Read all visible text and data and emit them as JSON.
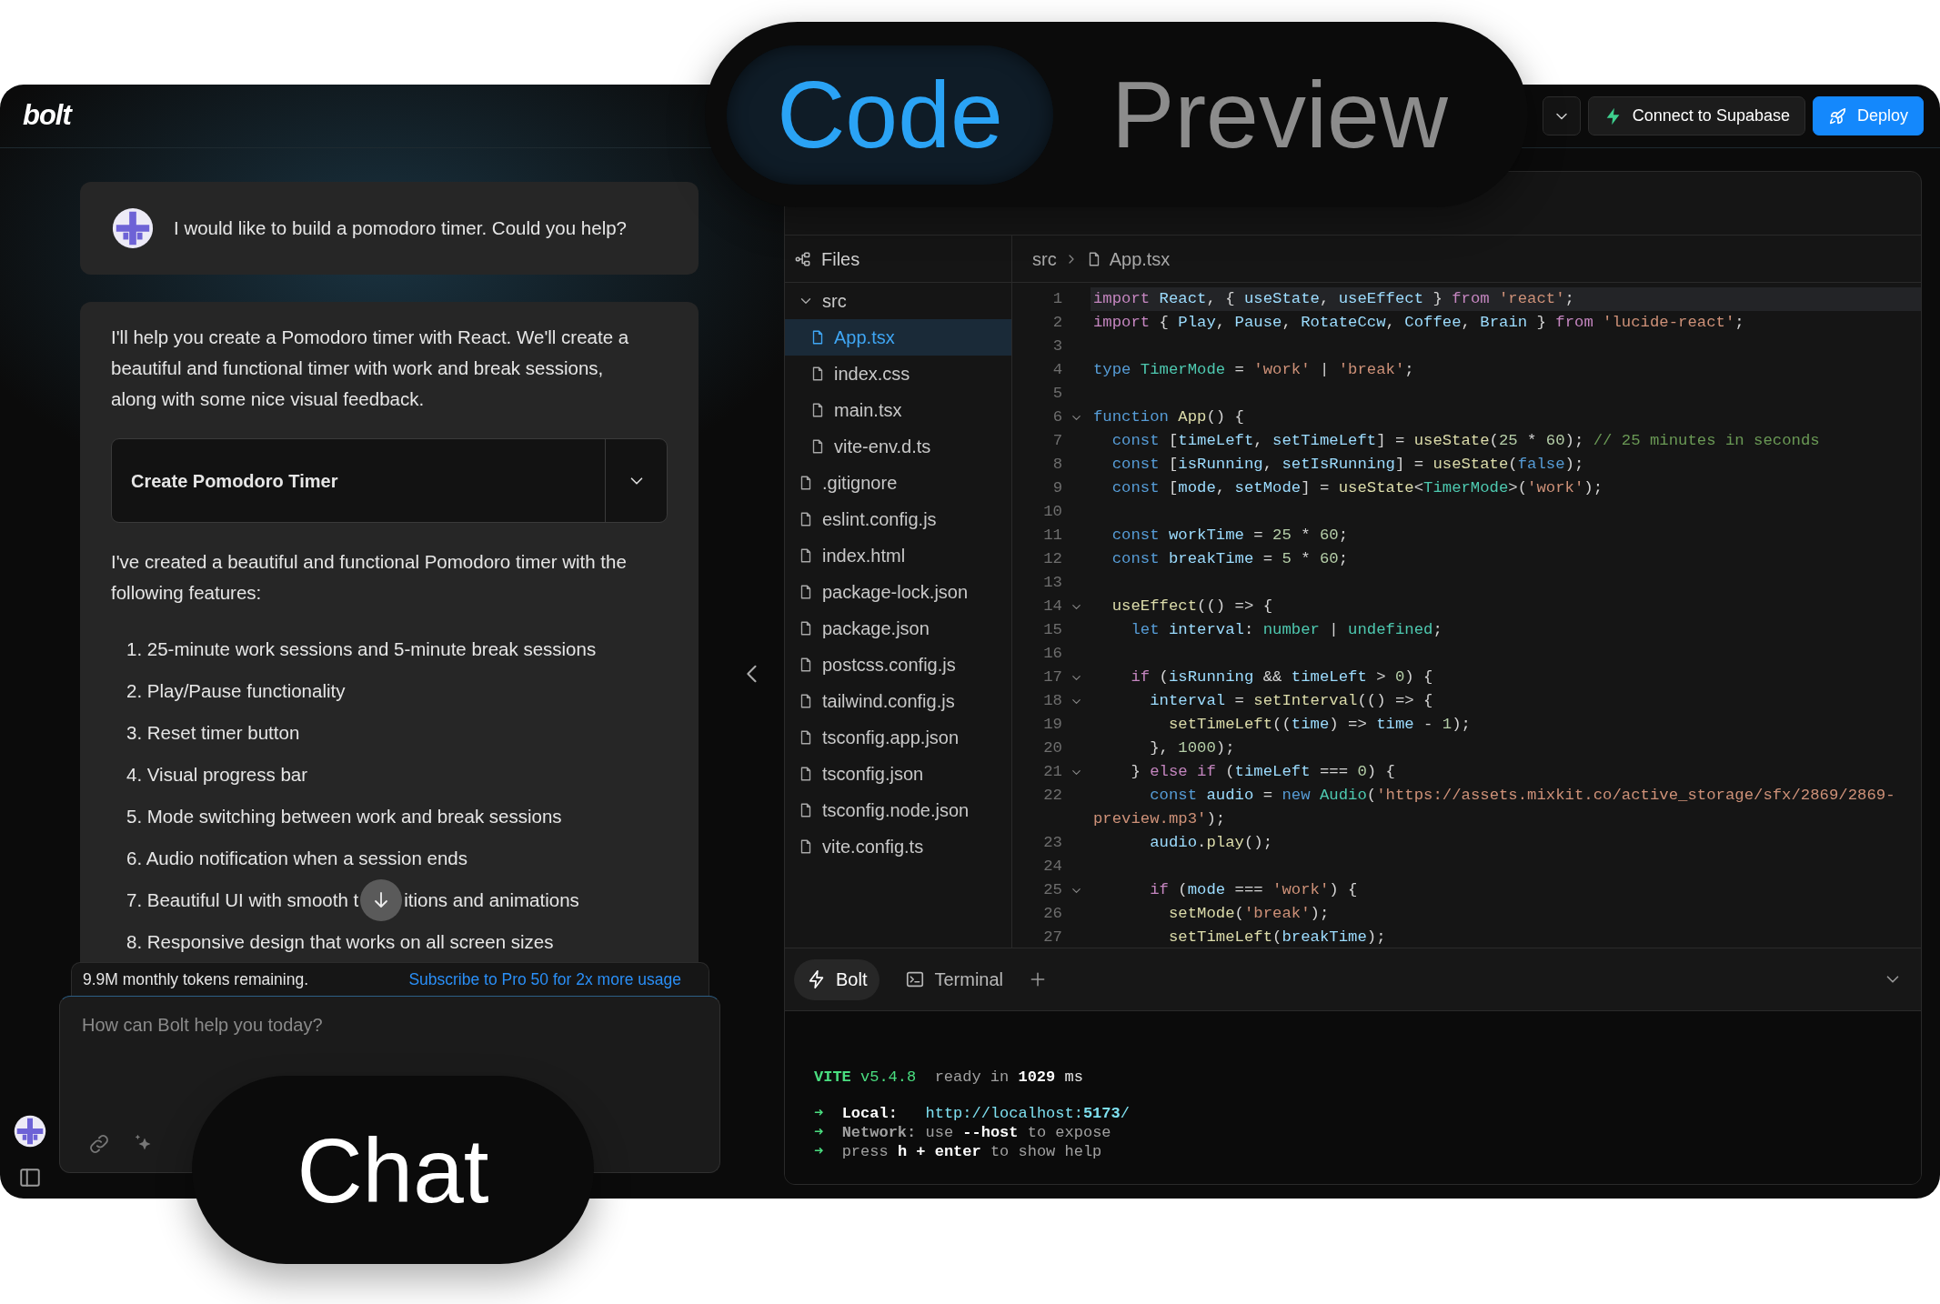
{
  "app": {
    "logo": "bolt"
  },
  "header_actions": [
    {
      "kind": "dropdown"
    },
    {
      "kind": "integration",
      "label": "Connect to Supabase"
    },
    {
      "kind": "primary",
      "label": "Deploy"
    }
  ],
  "chat": {
    "messages": [
      {
        "kind": "user",
        "text": "I would like to build a pomodoro timer. Could you help?"
      },
      {
        "kind": "assistant",
        "intro": "I'll help you create a Pomodoro timer with React. We'll create a beautiful and functional timer with work and break sessions, along with some nice visual feedback.",
        "artifact": {
          "title": "Create Pomodoro Timer",
          "expanded": false
        },
        "summary": "I've created a beautiful and functional Pomodoro timer with the following features:",
        "features": [
          "1. 25-minute work sessions and 5-minute break sessions",
          "2. Play/Pause functionality",
          "3. Reset timer button",
          "4. Visual progress bar",
          "5. Mode switching between work and break sessions",
          "6. Audio notification when a session ends",
          [
            "7. Beautiful UI with smooth t",
            "itions and animations"
          ],
          "8. Responsive design that works on all screen sizes"
        ]
      }
    ],
    "usage": {
      "remaining": "9.9M monthly tokens remaining.",
      "upgrade_link": "Subscribe to Pro 50 for 2x more usage"
    },
    "input": {
      "placeholder": "How can Bolt help you today?"
    }
  },
  "workbench": {
    "files_title": "Files",
    "tree": [
      {
        "name": "src",
        "kind": "folder",
        "expanded": true,
        "selected": false,
        "children": [
          {
            "name": "App.tsx",
            "kind": "file",
            "selected": true
          },
          {
            "name": "index.css",
            "kind": "file",
            "selected": false
          },
          {
            "name": "main.tsx",
            "kind": "file",
            "selected": false
          },
          {
            "name": "vite-env.d.ts",
            "kind": "file",
            "selected": false
          }
        ]
      },
      {
        "name": ".gitignore",
        "kind": "file",
        "selected": false
      },
      {
        "name": "eslint.config.js",
        "kind": "file",
        "selected": false
      },
      {
        "name": "index.html",
        "kind": "file",
        "selected": false
      },
      {
        "name": "package-lock.json",
        "kind": "file",
        "selected": false
      },
      {
        "name": "package.json",
        "kind": "file",
        "selected": false
      },
      {
        "name": "postcss.config.js",
        "kind": "file",
        "selected": false
      },
      {
        "name": "tailwind.config.js",
        "kind": "file",
        "selected": false
      },
      {
        "name": "tsconfig.app.json",
        "kind": "file",
        "selected": false
      },
      {
        "name": "tsconfig.json",
        "kind": "file",
        "selected": false
      },
      {
        "name": "tsconfig.node.json",
        "kind": "file",
        "selected": false
      },
      {
        "name": "vite.config.ts",
        "kind": "file",
        "selected": false
      }
    ],
    "breadcrumb": [
      "src",
      "App.tsx"
    ],
    "code_lines": [
      {
        "number": "1",
        "active": true,
        "foldable": false,
        "tokens": [
          {
            "kind": "keyword",
            "text": "import"
          },
          {
            "kind": "variable",
            "text": " React"
          },
          {
            "kind": "punct",
            "text": ", { "
          },
          {
            "kind": "variable",
            "text": "useState"
          },
          {
            "kind": "punct",
            "text": ", "
          },
          {
            "kind": "variable",
            "text": "useEffect"
          },
          {
            "kind": "punct",
            "text": " } "
          },
          {
            "kind": "keyword",
            "text": "from"
          },
          {
            "kind": "string",
            "text": " 'react'"
          },
          {
            "kind": "punct",
            "text": ";"
          }
        ]
      },
      {
        "number": "2",
        "active": false,
        "foldable": false,
        "tokens": [
          {
            "kind": "keyword",
            "text": "import"
          },
          {
            "kind": "punct",
            "text": " { "
          },
          {
            "kind": "variable",
            "text": "Play"
          },
          {
            "kind": "punct",
            "text": ", "
          },
          {
            "kind": "variable",
            "text": "Pause"
          },
          {
            "kind": "punct",
            "text": ", "
          },
          {
            "kind": "variable",
            "text": "RotateCcw"
          },
          {
            "kind": "punct",
            "text": ", "
          },
          {
            "kind": "variable",
            "text": "Coffee"
          },
          {
            "kind": "punct",
            "text": ", "
          },
          {
            "kind": "variable",
            "text": "Brain"
          },
          {
            "kind": "punct",
            "text": " } "
          },
          {
            "kind": "keyword",
            "text": "from"
          },
          {
            "kind": "string",
            "text": " 'lucide-react'"
          },
          {
            "kind": "punct",
            "text": ";"
          }
        ]
      },
      {
        "number": "3",
        "active": false,
        "foldable": false
      },
      {
        "number": "4",
        "active": false,
        "foldable": false,
        "tokens": [
          {
            "kind": "storage",
            "text": "type"
          },
          {
            "kind": "type",
            "text": " TimerMode"
          },
          {
            "kind": "punct",
            "text": " = "
          },
          {
            "kind": "string",
            "text": "'work'"
          },
          {
            "kind": "punct",
            "text": " | "
          },
          {
            "kind": "string",
            "text": "'break'"
          },
          {
            "kind": "punct",
            "text": ";"
          }
        ]
      },
      {
        "number": "5",
        "active": false,
        "foldable": false
      },
      {
        "number": "6",
        "active": false,
        "foldable": true,
        "tokens": [
          {
            "kind": "storage",
            "text": "function"
          },
          {
            "kind": "function",
            "text": " App"
          },
          {
            "kind": "punct",
            "text": "() {"
          }
        ]
      },
      {
        "number": "7",
        "active": false,
        "foldable": false,
        "tokens": [
          {
            "kind": "storage",
            "text": "  const"
          },
          {
            "kind": "punct",
            "text": " ["
          },
          {
            "kind": "variable",
            "text": "timeLeft"
          },
          {
            "kind": "punct",
            "text": ", "
          },
          {
            "kind": "variable",
            "text": "setTimeLeft"
          },
          {
            "kind": "punct",
            "text": "] = "
          },
          {
            "kind": "function",
            "text": "useState"
          },
          {
            "kind": "punct",
            "text": "("
          },
          {
            "kind": "number",
            "text": "25"
          },
          {
            "kind": "punct",
            "text": " * "
          },
          {
            "kind": "number",
            "text": "60"
          },
          {
            "kind": "punct",
            "text": "); "
          },
          {
            "kind": "comment",
            "text": "// 25 minutes in seconds"
          }
        ]
      },
      {
        "number": "8",
        "active": false,
        "foldable": false,
        "tokens": [
          {
            "kind": "storage",
            "text": "  const"
          },
          {
            "kind": "punct",
            "text": " ["
          },
          {
            "kind": "variable",
            "text": "isRunning"
          },
          {
            "kind": "punct",
            "text": ", "
          },
          {
            "kind": "variable",
            "text": "setIsRunning"
          },
          {
            "kind": "punct",
            "text": "] = "
          },
          {
            "kind": "function",
            "text": "useState"
          },
          {
            "kind": "punct",
            "text": "("
          },
          {
            "kind": "storage",
            "text": "false"
          },
          {
            "kind": "punct",
            "text": ");"
          }
        ]
      },
      {
        "number": "9",
        "active": false,
        "foldable": false,
        "tokens": [
          {
            "kind": "storage",
            "text": "  const"
          },
          {
            "kind": "punct",
            "text": " ["
          },
          {
            "kind": "variable",
            "text": "mode"
          },
          {
            "kind": "punct",
            "text": ", "
          },
          {
            "kind": "variable",
            "text": "setMode"
          },
          {
            "kind": "punct",
            "text": "] = "
          },
          {
            "kind": "function",
            "text": "useState"
          },
          {
            "kind": "punct",
            "text": "<"
          },
          {
            "kind": "type",
            "text": "TimerMode"
          },
          {
            "kind": "punct",
            "text": ">("
          },
          {
            "kind": "string",
            "text": "'work'"
          },
          {
            "kind": "punct",
            "text": ");"
          }
        ]
      },
      {
        "number": "10",
        "active": false,
        "foldable": false
      },
      {
        "number": "11",
        "active": false,
        "foldable": false,
        "tokens": [
          {
            "kind": "storage",
            "text": "  const"
          },
          {
            "kind": "variable",
            "text": " workTime"
          },
          {
            "kind": "punct",
            "text": " = "
          },
          {
            "kind": "number",
            "text": "25"
          },
          {
            "kind": "punct",
            "text": " * "
          },
          {
            "kind": "number",
            "text": "60"
          },
          {
            "kind": "punct",
            "text": ";"
          }
        ]
      },
      {
        "number": "12",
        "active": false,
        "foldable": false,
        "tokens": [
          {
            "kind": "storage",
            "text": "  const"
          },
          {
            "kind": "variable",
            "text": " breakTime"
          },
          {
            "kind": "punct",
            "text": " = "
          },
          {
            "kind": "number",
            "text": "5"
          },
          {
            "kind": "punct",
            "text": " * "
          },
          {
            "kind": "number",
            "text": "60"
          },
          {
            "kind": "punct",
            "text": ";"
          }
        ]
      },
      {
        "number": "13",
        "active": false,
        "foldable": false
      },
      {
        "number": "14",
        "active": false,
        "foldable": true,
        "tokens": [
          {
            "kind": "function",
            "text": "  useEffect"
          },
          {
            "kind": "punct",
            "text": "(() => {"
          }
        ]
      },
      {
        "number": "15",
        "active": false,
        "foldable": false,
        "tokens": [
          {
            "kind": "storage",
            "text": "    let"
          },
          {
            "kind": "variable",
            "text": " interval"
          },
          {
            "kind": "punct",
            "text": ": "
          },
          {
            "kind": "type",
            "text": "number"
          },
          {
            "kind": "punct",
            "text": " | "
          },
          {
            "kind": "type",
            "text": "undefined"
          },
          {
            "kind": "punct",
            "text": ";"
          }
        ]
      },
      {
        "number": "16",
        "active": false,
        "foldable": false
      },
      {
        "number": "17",
        "active": false,
        "foldable": true,
        "tokens": [
          {
            "kind": "keyword",
            "text": "    if"
          },
          {
            "kind": "punct",
            "text": " ("
          },
          {
            "kind": "variable",
            "text": "isRunning"
          },
          {
            "kind": "punct",
            "text": " && "
          },
          {
            "kind": "variable",
            "text": "timeLeft"
          },
          {
            "kind": "punct",
            "text": " > "
          },
          {
            "kind": "number",
            "text": "0"
          },
          {
            "kind": "punct",
            "text": ") {"
          }
        ]
      },
      {
        "number": "18",
        "active": false,
        "foldable": true,
        "tokens": [
          {
            "kind": "variable",
            "text": "      interval"
          },
          {
            "kind": "punct",
            "text": " = "
          },
          {
            "kind": "function",
            "text": "setInterval"
          },
          {
            "kind": "punct",
            "text": "(() => {"
          }
        ]
      },
      {
        "number": "19",
        "active": false,
        "foldable": false,
        "tokens": [
          {
            "kind": "function",
            "text": "        setTimeLeft"
          },
          {
            "kind": "punct",
            "text": "(("
          },
          {
            "kind": "variable",
            "text": "time"
          },
          {
            "kind": "punct",
            "text": ") => "
          },
          {
            "kind": "variable",
            "text": "time"
          },
          {
            "kind": "punct",
            "text": " - "
          },
          {
            "kind": "number",
            "text": "1"
          },
          {
            "kind": "punct",
            "text": ");"
          }
        ]
      },
      {
        "number": "20",
        "active": false,
        "foldable": false,
        "tokens": [
          {
            "kind": "punct",
            "text": "      }, "
          },
          {
            "kind": "number",
            "text": "1000"
          },
          {
            "kind": "punct",
            "text": ");"
          }
        ]
      },
      {
        "number": "21",
        "active": false,
        "foldable": true,
        "tokens": [
          {
            "kind": "punct",
            "text": "    } "
          },
          {
            "kind": "keyword",
            "text": "else"
          },
          {
            "kind": "keyword",
            "text": " if"
          },
          {
            "kind": "punct",
            "text": " ("
          },
          {
            "kind": "variable",
            "text": "timeLeft"
          },
          {
            "kind": "punct",
            "text": " === "
          },
          {
            "kind": "number",
            "text": "0"
          },
          {
            "kind": "punct",
            "text": ") {"
          }
        ]
      },
      {
        "number": "22",
        "active": false,
        "foldable": false,
        "tokens": [
          {
            "kind": "storage",
            "text": "      const"
          },
          {
            "kind": "variable",
            "text": " audio"
          },
          {
            "kind": "punct",
            "text": " = "
          },
          {
            "kind": "storage",
            "text": "new"
          },
          {
            "kind": "type",
            "text": " Audio"
          },
          {
            "kind": "punct",
            "text": "("
          },
          {
            "kind": "string",
            "text": "'https://assets.mixkit.co/active_storage/sfx/2869/2869-preview.mp3'"
          },
          {
            "kind": "punct",
            "text": ");"
          }
        ]
      },
      {
        "number": "23",
        "active": false,
        "foldable": false,
        "tokens": [
          {
            "kind": "variable",
            "text": "      audio"
          },
          {
            "kind": "punct",
            "text": "."
          },
          {
            "kind": "function",
            "text": "play"
          },
          {
            "kind": "punct",
            "text": "();"
          }
        ]
      },
      {
        "number": "24",
        "active": false,
        "foldable": false
      },
      {
        "number": "25",
        "active": false,
        "foldable": true,
        "tokens": [
          {
            "kind": "keyword",
            "text": "      if"
          },
          {
            "kind": "punct",
            "text": " ("
          },
          {
            "kind": "variable",
            "text": "mode"
          },
          {
            "kind": "punct",
            "text": " === "
          },
          {
            "kind": "string",
            "text": "'work'"
          },
          {
            "kind": "punct",
            "text": ") {"
          }
        ]
      },
      {
        "number": "26",
        "active": false,
        "foldable": false,
        "tokens": [
          {
            "kind": "function",
            "text": "        setMode"
          },
          {
            "kind": "punct",
            "text": "("
          },
          {
            "kind": "string",
            "text": "'break'"
          },
          {
            "kind": "punct",
            "text": ");"
          }
        ]
      },
      {
        "number": "27",
        "active": false,
        "foldable": false,
        "tokens": [
          {
            "kind": "function",
            "text": "        setTimeLeft"
          },
          {
            "kind": "punct",
            "text": "("
          },
          {
            "kind": "variable",
            "text": "breakTime"
          },
          {
            "kind": "punct",
            "text": ");"
          }
        ]
      }
    ],
    "panel_tabs": [
      {
        "kind": "bolt",
        "label": "Bolt",
        "selected": true
      },
      {
        "kind": "terminal",
        "label": "Terminal",
        "selected": false
      }
    ],
    "terminal_lines": [
      [
        {
          "kind": "accent-bold",
          "text": "VITE"
        },
        {
          "kind": "accent",
          "text": " v5.4.8"
        },
        {
          "kind": "dim",
          "text": "  ready in "
        },
        {
          "kind": "bright-bold",
          "text": "1029"
        },
        {
          "kind": "bright",
          "text": " ms"
        }
      ],
      [
        {
          "kind": "accent",
          "text": "➜"
        },
        {
          "kind": "bright-bold",
          "text": "  Local:"
        },
        {
          "kind": "link",
          "text": "   http://localhost:"
        },
        {
          "kind": "link-bold",
          "text": "5173"
        },
        {
          "kind": "link",
          "text": "/"
        }
      ],
      [
        {
          "kind": "accent",
          "text": "➜"
        },
        {
          "kind": "dim-bold",
          "text": "  Network:"
        },
        {
          "kind": "dim",
          "text": " use "
        },
        {
          "kind": "bright-bold",
          "text": "--host"
        },
        {
          "kind": "dim",
          "text": " to expose"
        }
      ],
      [
        {
          "kind": "accent",
          "text": "➜"
        },
        {
          "kind": "dim",
          "text": "  press "
        },
        {
          "kind": "bright-bold",
          "text": "h + enter"
        },
        {
          "kind": "dim",
          "text": " to show help"
        }
      ]
    ]
  },
  "overlay": {
    "view_tabs": [
      {
        "label": "Code",
        "selected": true
      },
      {
        "label": "Preview",
        "selected": false
      }
    ],
    "chat_label": "Chat"
  }
}
